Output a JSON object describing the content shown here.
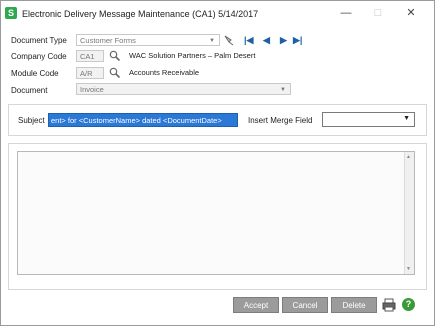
{
  "window": {
    "title": "Electronic Delivery Message Maintenance (CA1) 5/14/2017",
    "app_icon_letter": "S",
    "minimize": "—",
    "maximize": "□",
    "close": "✕"
  },
  "form": {
    "document_type": {
      "label": "Document Type",
      "value": "Customer Forms"
    },
    "company_code": {
      "label": "Company Code",
      "value": "CA1",
      "description": "WAC Solution Partners – Palm Desert"
    },
    "module_code": {
      "label": "Module Code",
      "value": "A/R",
      "description": "Accounts Receivable"
    },
    "document": {
      "label": "Document",
      "value": "Invoice"
    }
  },
  "subject": {
    "label": "Subject",
    "value": "ent> for <CustomerName> dated <DocumentDate>",
    "merge_label": "Insert Merge Field",
    "merge_value": ""
  },
  "buttons": {
    "accept": "Accept",
    "cancel": "Cancel",
    "delete": "Delete"
  },
  "icons": {
    "help": "?"
  }
}
